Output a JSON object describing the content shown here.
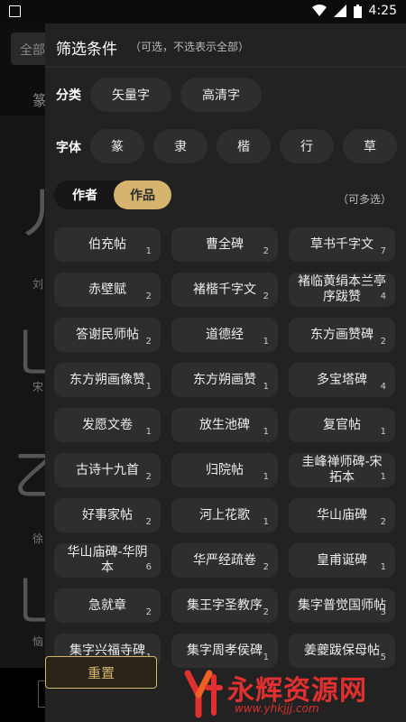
{
  "status_bar": {
    "time": "4:25"
  },
  "background": {
    "search_prefix": "全部",
    "tab": "篆",
    "glyph_labels": [
      "刘",
      "宋",
      "徐",
      "恼"
    ]
  },
  "filter": {
    "title": "筛选条件",
    "subtitle": "（可选，不选表示全部）",
    "category": {
      "label": "分类",
      "options": [
        "矢量字",
        "高清字"
      ]
    },
    "font": {
      "label": "字体",
      "options": [
        "篆",
        "隶",
        "楷",
        "行",
        "草"
      ]
    },
    "toggle": {
      "author": "作者",
      "work": "作品",
      "active": "work"
    },
    "multi_hint": "（可多选）",
    "works": [
      {
        "name": "伯充帖",
        "count": "1"
      },
      {
        "name": "曹全碑",
        "count": "2"
      },
      {
        "name": "草书千字文",
        "count": "7"
      },
      {
        "name": "赤壁赋",
        "count": "2"
      },
      {
        "name": "褚楷千字文",
        "count": "2"
      },
      {
        "name": "褚临黄绢本兰亭序跋赞",
        "count": "4"
      },
      {
        "name": "答谢民师帖",
        "count": "2"
      },
      {
        "name": "道德经",
        "count": "1"
      },
      {
        "name": "东方画赞碑",
        "count": "2"
      },
      {
        "name": "东方朔画像赞",
        "count": "1"
      },
      {
        "name": "东方朔画赞",
        "count": "1"
      },
      {
        "name": "多宝塔碑",
        "count": "4"
      },
      {
        "name": "发愿文卷",
        "count": "1"
      },
      {
        "name": "放生池碑",
        "count": "1"
      },
      {
        "name": "复官帖",
        "count": "1"
      },
      {
        "name": "古诗十九首",
        "count": "2"
      },
      {
        "name": "归院帖",
        "count": "1"
      },
      {
        "name": "圭峰禅师碑-宋拓本",
        "count": "1"
      },
      {
        "name": "好事家帖",
        "count": "2"
      },
      {
        "name": "河上花歌",
        "count": "1"
      },
      {
        "name": "华山庙碑",
        "count": "2"
      },
      {
        "name": "华山庙碑-华阴本",
        "count": "6"
      },
      {
        "name": "华严经疏卷",
        "count": "2"
      },
      {
        "name": "皇甫诞碑",
        "count": "1"
      },
      {
        "name": "急就章",
        "count": "2"
      },
      {
        "name": "集王字圣教序",
        "count": "2"
      },
      {
        "name": "集字普觉国师帖",
        "count": "3"
      },
      {
        "name": "集字兴福寺碑",
        "count": "1"
      },
      {
        "name": "集字周孝侯碑",
        "count": "1"
      },
      {
        "name": "姜夔跋保母帖",
        "count": "5"
      }
    ],
    "reset_label": "重置"
  },
  "watermark": {
    "brand": "永辉资源网",
    "url": "www.yhkjjj.com"
  }
}
